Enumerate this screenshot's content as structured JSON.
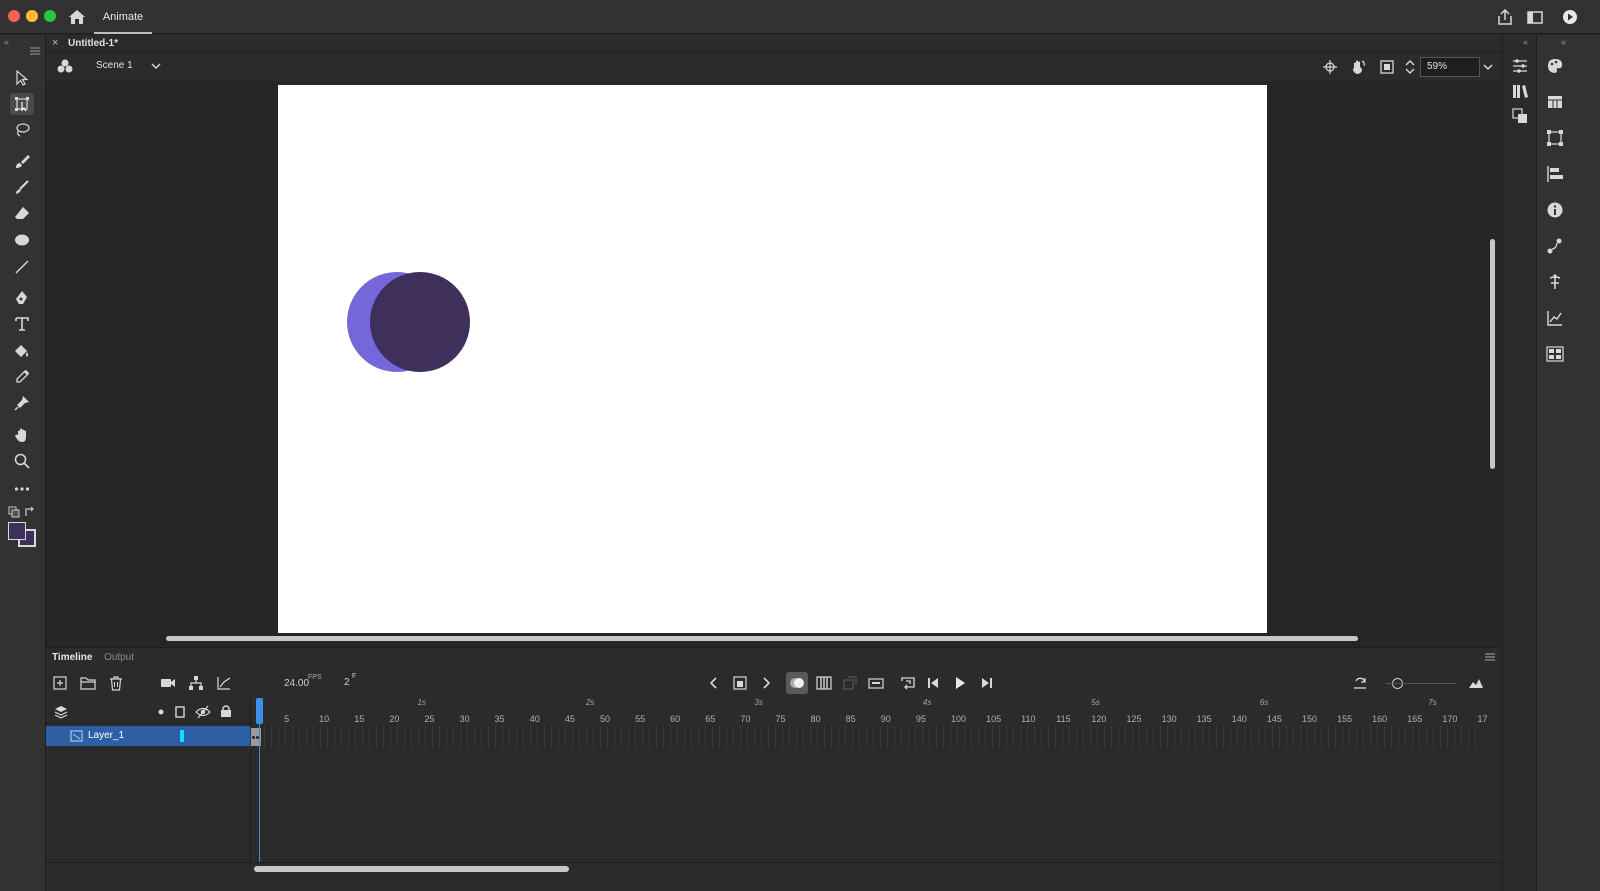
{
  "titlebar": {
    "app_tab": "Animate",
    "icons": [
      "home-icon",
      "share-icon",
      "workspace-icon",
      "publish-play-icon"
    ]
  },
  "document": {
    "tab_title": "Untitled-1*",
    "close_glyph": "×"
  },
  "editbar": {
    "scene": "Scene 1",
    "zoom": "59%"
  },
  "tools": [
    "selection-tool-icon",
    "free-transform-tool-icon",
    "lasso-tool-icon",
    "paint-brush-tool-icon",
    "brush-tool-icon",
    "eraser-tool-icon",
    "oval-tool-icon",
    "line-tool-icon",
    "pen-tool-icon",
    "text-tool-icon",
    "paint-bucket-tool-icon",
    "eyedropper-tool-icon",
    "asset-warp-tool-icon",
    "hand-tool-icon",
    "zoom-tool-icon",
    "more-tools-icon"
  ],
  "colors": {
    "stroke": "#3f2f5b",
    "fill": "#3f2f5b",
    "circle_light": "#7567d9",
    "circle_dark": "#3f2f5b",
    "layer_highlight": "#2d5fa7",
    "layer_color_tag": "#00e5ff",
    "playhead": "#3b8fe8"
  },
  "timeline": {
    "tabs": [
      "Timeline",
      "Output"
    ],
    "fps": "24.00",
    "fps_unit": "FPS",
    "current_frame": "2",
    "current_frame_unit": "F",
    "layers": [
      {
        "name": "Layer_1"
      }
    ],
    "seconds": [
      "1s",
      "2s",
      "3s",
      "4s",
      "5s",
      "6s",
      "7s"
    ],
    "frames": [
      "5",
      "10",
      "15",
      "20",
      "25",
      "30",
      "35",
      "40",
      "45",
      "50",
      "55",
      "60",
      "65",
      "70",
      "75",
      "80",
      "85",
      "90",
      "95",
      "100",
      "105",
      "110",
      "115",
      "120",
      "125",
      "130",
      "135",
      "140",
      "145",
      "150",
      "155",
      "160",
      "165",
      "170",
      "17"
    ]
  }
}
